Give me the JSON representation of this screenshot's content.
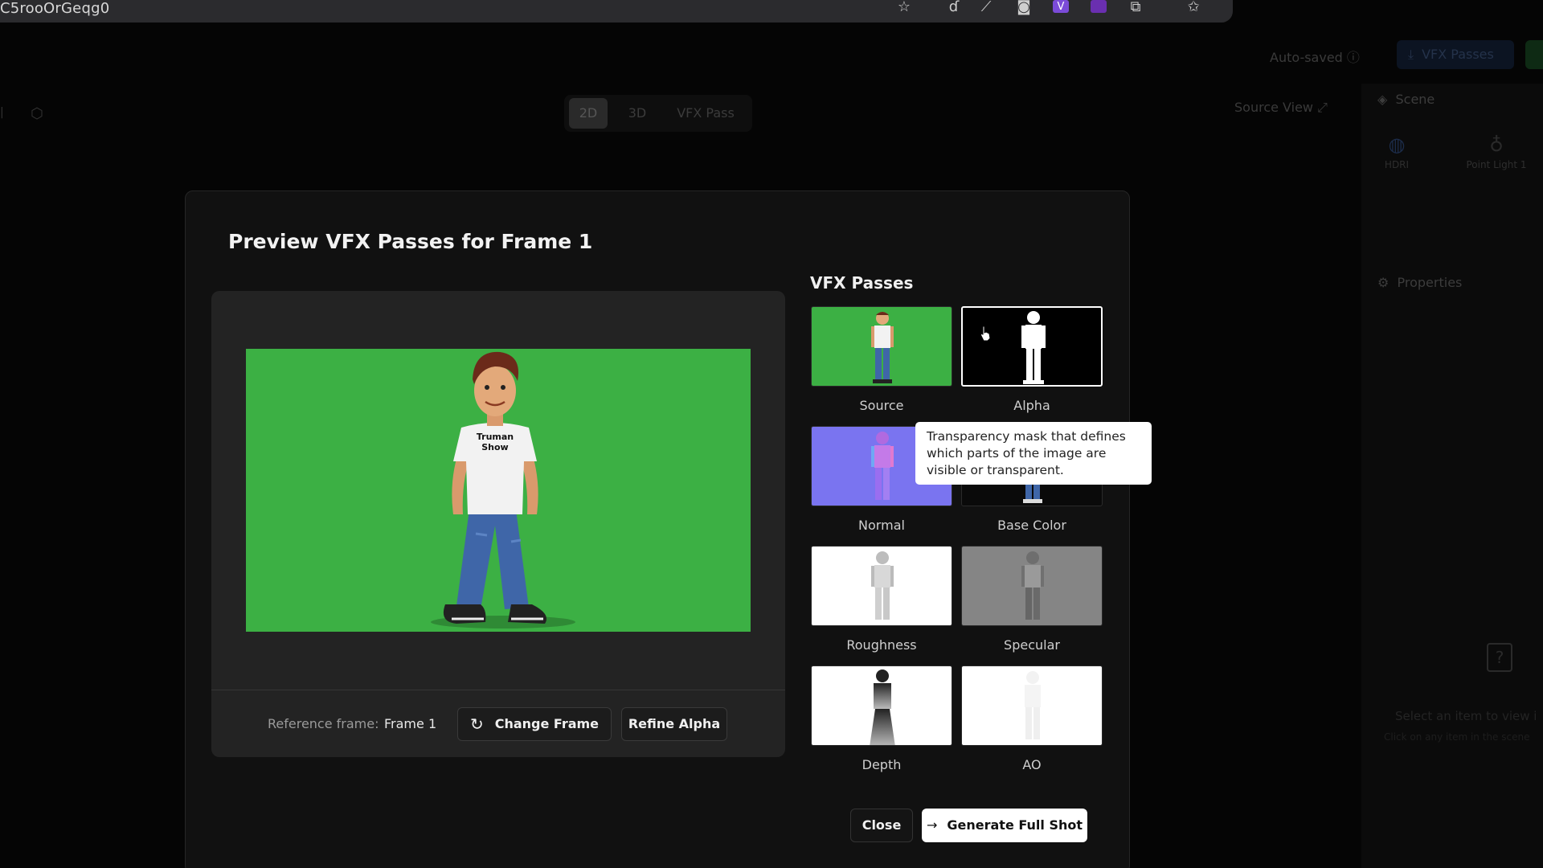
{
  "browser": {
    "title": "C5rooOrGeqg0",
    "icons": [
      "star-icon",
      "pen-icon",
      "eyedropper-icon",
      "camera-icon",
      "v-extension-icon",
      "purple-extension-icon",
      "puzzle-icon",
      "bookmark-star-icon"
    ]
  },
  "header": {
    "autosaved": "Auto-saved",
    "export_button": "VFX Passes"
  },
  "mode_toggle": {
    "items": [
      {
        "label": "2D",
        "active": true
      },
      {
        "label": "3D",
        "active": false
      },
      {
        "label": "VFX Pass",
        "active": false
      }
    ]
  },
  "source_view": "Source View",
  "right_panel": {
    "scene_label": "Scene",
    "items": [
      {
        "label": "HDRI",
        "icon": "globe-icon"
      },
      {
        "label": "Point Light 1",
        "icon": "bulb-icon"
      }
    ],
    "properties_label": "Properties",
    "hint_title": "Select an item to view i",
    "hint_sub": "Click on any item in the scene"
  },
  "modal": {
    "title": "Preview VFX Passes for Frame 1",
    "preview_shirt_text": "Truman Show",
    "reference_label": "Reference frame:",
    "reference_value": "Frame 1",
    "change_frame": "Change Frame",
    "refine_alpha": "Refine Alpha",
    "passes_title": "VFX Passes",
    "passes": [
      {
        "label": "Source",
        "selected": false
      },
      {
        "label": "Alpha",
        "selected": true
      },
      {
        "label": "Normal",
        "selected": false
      },
      {
        "label": "Base Color",
        "selected": false
      },
      {
        "label": "Roughness",
        "selected": false
      },
      {
        "label": "Specular",
        "selected": false
      },
      {
        "label": "Depth",
        "selected": false
      },
      {
        "label": "AO",
        "selected": false
      }
    ],
    "tooltip": "Transparency mask that defines which parts of the image are visible or transparent.",
    "close": "Close",
    "generate": "Generate Full Shot"
  },
  "colors": {
    "green_screen": "#3cb044",
    "normal_bg": "#7a74f0",
    "modal_bg": "#111111"
  }
}
